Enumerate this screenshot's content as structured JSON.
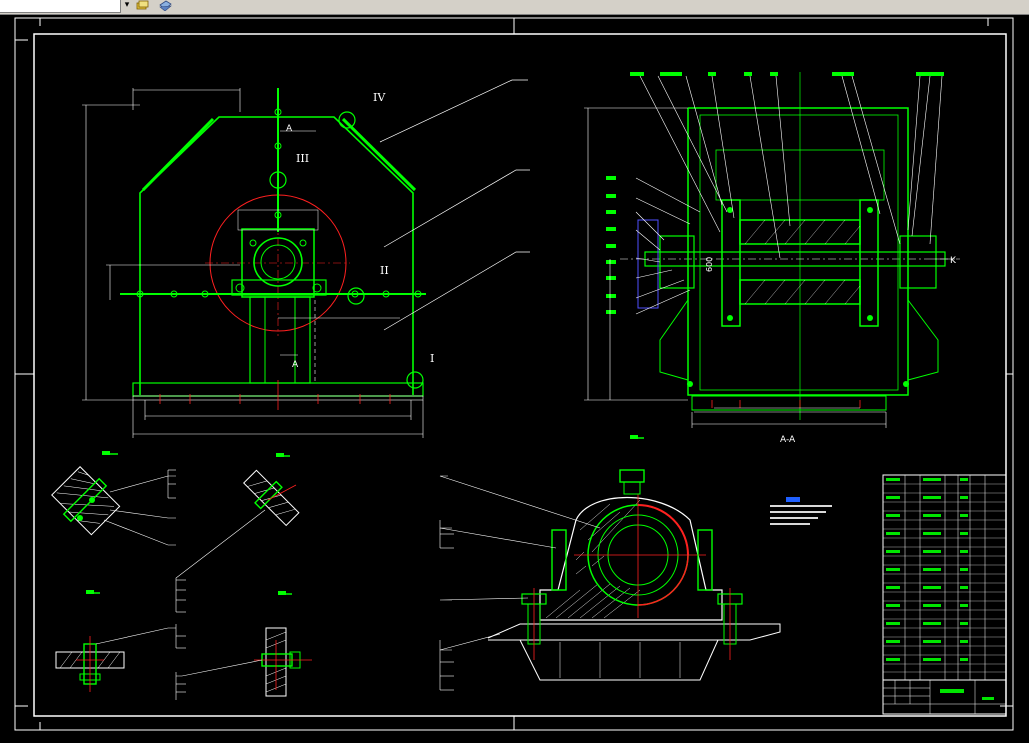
{
  "toolbar": {
    "layer_field_value": "",
    "dropdown_glyph": "▾",
    "icons": [
      "layer-states-icon",
      "layer-previous-icon"
    ]
  },
  "drawing": {
    "front_view": {
      "balloons": [
        "IV",
        "III",
        "II",
        "I"
      ],
      "section_marks": [
        "A",
        "A"
      ]
    },
    "side_view": {
      "caption": "A-A",
      "marker": "K",
      "dim_600": "600"
    },
    "colors": {
      "background": "#000000",
      "outline": "#00ff00",
      "border": "#ffffff",
      "leader": "#ffffff",
      "dimension": "#ffffff",
      "centerline": "#ff0000",
      "hatch": "#ffffff",
      "yellow": "#ffff00",
      "note_highlight": "#2060ff"
    }
  }
}
